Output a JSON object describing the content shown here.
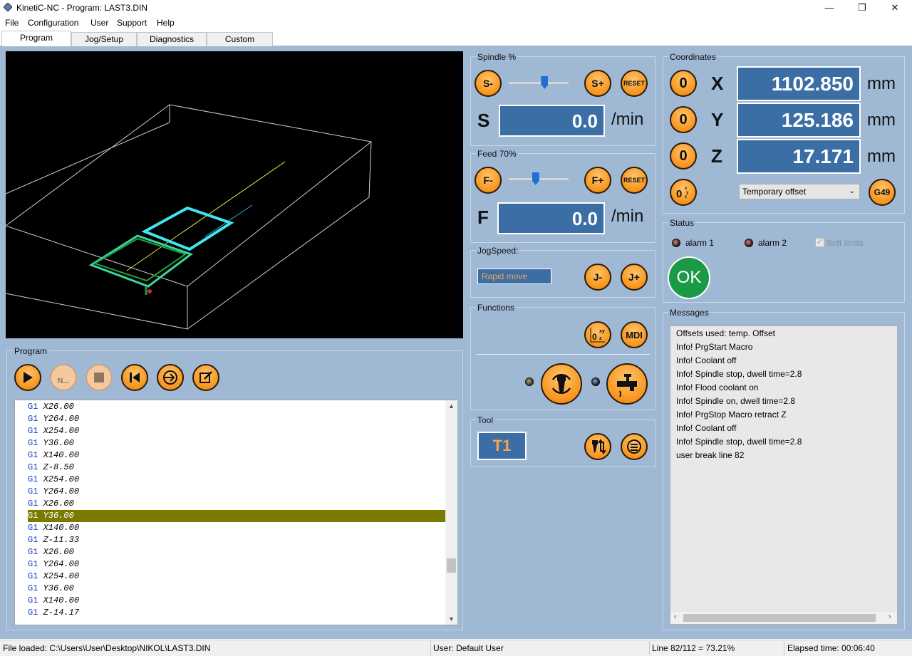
{
  "window": {
    "title": "KinetiC-NC - Program: LAST3.DIN",
    "controls": {
      "minimize": "—",
      "maximize": "❐",
      "close": "✕"
    }
  },
  "menu": [
    "File",
    "Configuration",
    "User",
    "Support",
    "Help"
  ],
  "tabs": [
    {
      "label": "Program",
      "active": true
    },
    {
      "label": "Jog/Setup",
      "active": false
    },
    {
      "label": "Diagnostics",
      "active": false
    },
    {
      "label": "Custom",
      "active": false
    }
  ],
  "program": {
    "group_label": "Program",
    "buttons": {
      "run": "play-icon",
      "next": "N...",
      "stop": "stop-icon",
      "rewind": "skip-back-icon",
      "goto": "goto-icon",
      "edit": "edit-icon"
    },
    "lines": [
      {
        "g": "G1",
        "rest": " X26.00"
      },
      {
        "g": "G1",
        "rest": " Y264.00"
      },
      {
        "g": "G1",
        "rest": " X254.00"
      },
      {
        "g": "G1",
        "rest": " Y36.00"
      },
      {
        "g": "G1",
        "rest": " X140.00"
      },
      {
        "g": "G1",
        "rest": " Z-8.50"
      },
      {
        "g": "G1",
        "rest": " X254.00"
      },
      {
        "g": "G1",
        "rest": " Y264.00"
      },
      {
        "g": "G1",
        "rest": " X26.00"
      },
      {
        "g": "G1",
        "rest": " Y36.00",
        "highlighted": true
      },
      {
        "g": "G1",
        "rest": " X140.00"
      },
      {
        "g": "G1",
        "rest": " Z-11.33"
      },
      {
        "g": "G1",
        "rest": " X26.00"
      },
      {
        "g": "G1",
        "rest": " Y264.00"
      },
      {
        "g": "G1",
        "rest": " X254.00"
      },
      {
        "g": "G1",
        "rest": " Y36.00"
      },
      {
        "g": "G1",
        "rest": " X140.00"
      },
      {
        "g": "G1",
        "rest": " Z-14.17"
      }
    ]
  },
  "spindle": {
    "label": "Spindle %",
    "minus": "S-",
    "plus": "S+",
    "reset": "RESET",
    "letter": "S",
    "value": "0.0",
    "unit": "/min",
    "slider_fraction": 0.6
  },
  "feed": {
    "label": "Feed 70%",
    "minus": "F-",
    "plus": "F+",
    "reset": "RESET",
    "letter": "F",
    "value": "0.0",
    "unit": "/min",
    "slider_fraction": 0.45
  },
  "jog": {
    "label": "JogSpeed:",
    "mode": "Rapid move",
    "minus": "J-",
    "plus": "J+"
  },
  "functions": {
    "label": "Functions",
    "mdi": "MDI",
    "zero_xyz": "0xyz",
    "spindle_icon": "spindle-icon",
    "coolant_icon": "coolant-tap-icon"
  },
  "tool": {
    "label": "Tool",
    "value": "T1",
    "change_icon": "tool-change-icon",
    "table_icon": "tool-table-icon"
  },
  "coordinates": {
    "label": "Coordinates",
    "axes": [
      {
        "zero": "0",
        "axis": "X",
        "value": "1102.850",
        "unit": "mm"
      },
      {
        "zero": "0",
        "axis": "Y",
        "value": "125.186",
        "unit": "mm"
      },
      {
        "zero": "0",
        "axis": "Z",
        "value": "17.171",
        "unit": "mm"
      }
    ],
    "zero_all": "0xyz",
    "offset_select": "Temporary offset",
    "g49": "G49"
  },
  "status": {
    "label": "Status",
    "alarm1": "alarm 1",
    "alarm2": "alarm 2",
    "soft_limits": "Soft limits",
    "ok": "OK"
  },
  "messages": {
    "label": "Messages",
    "lines": [
      "Offsets used: temp. Offset",
      "Info! PrgStart Macro",
      "Info! Coolant off",
      "Info! Spindle stop, dwell time=2.8",
      "Info! Flood coolant on",
      "Info! Spindle on, dwell time=2.8",
      "Info! PrgStop Macro retract Z",
      "Info! Coolant off",
      "Info! Spindle stop, dwell time=2.8",
      "user break line 82"
    ]
  },
  "statusbar": {
    "file": "File loaded: C:\\Users\\User\\Desktop\\NIKOL\\LAST3.DIN",
    "user": "User: Default User",
    "line": "Line 82/112 = 73.21%",
    "elapsed": "Elapsed time: 00:06:40"
  }
}
